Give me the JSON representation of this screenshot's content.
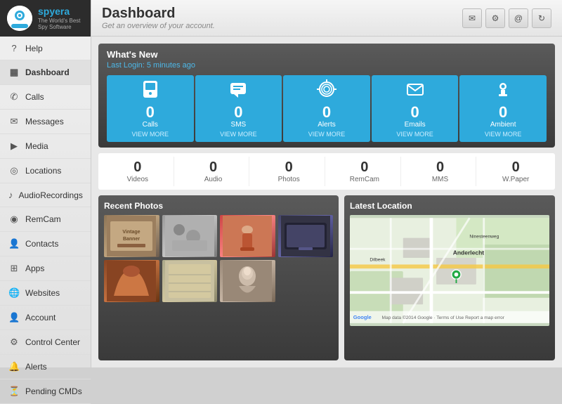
{
  "logo": {
    "text": "spyera",
    "sub": "The World's Best Spy Software"
  },
  "sidebar": {
    "items": [
      {
        "id": "help",
        "label": "Help",
        "icon": "?"
      },
      {
        "id": "dashboard",
        "label": "Dashboard",
        "icon": "▦",
        "active": true
      },
      {
        "id": "calls",
        "label": "Calls",
        "icon": "✆"
      },
      {
        "id": "messages",
        "label": "Messages",
        "icon": "✉"
      },
      {
        "id": "media",
        "label": "Media",
        "icon": "▶"
      },
      {
        "id": "locations",
        "label": "Locations",
        "icon": "◎"
      },
      {
        "id": "audiorecordings",
        "label": "AudioRecordings",
        "icon": "♪"
      },
      {
        "id": "remcam",
        "label": "RemCam",
        "icon": "◉"
      },
      {
        "id": "contacts",
        "label": "Contacts",
        "icon": "👤"
      },
      {
        "id": "apps",
        "label": "Apps",
        "icon": "⊞"
      },
      {
        "id": "websites",
        "label": "Websites",
        "icon": "🌐"
      },
      {
        "id": "account",
        "label": "Account",
        "icon": "👤"
      },
      {
        "id": "control-center",
        "label": "Control Center",
        "icon": "⚙"
      },
      {
        "id": "alerts",
        "label": "Alerts",
        "icon": "🔔"
      },
      {
        "id": "pending-cmds",
        "label": "Pending CMDs",
        "icon": "⏳"
      }
    ]
  },
  "header": {
    "title": "Dashboard",
    "subtitle": "Get an overview of your account.",
    "icons": [
      "✉",
      "⚙",
      "@",
      "↻"
    ]
  },
  "whats_new": {
    "title": "What's New",
    "last_login_label": "Last Login: 5 minutes ago"
  },
  "stats": [
    {
      "label": "Calls",
      "count": "0",
      "view_more": "VIEW MORE",
      "icon": "☎"
    },
    {
      "label": "SMS",
      "count": "0",
      "view_more": "VIEW MORE",
      "icon": "💬"
    },
    {
      "label": "Alerts",
      "count": "0",
      "view_more": "VIEW MORE",
      "icon": "📡"
    },
    {
      "label": "Emails",
      "count": "0",
      "view_more": "VIEW MORE",
      "icon": "✉"
    },
    {
      "label": "Ambient",
      "count": "0",
      "view_more": "VIEW MORE",
      "icon": "🎙"
    }
  ],
  "secondary_stats": [
    {
      "label": "Videos",
      "count": "0"
    },
    {
      "label": "Audio",
      "count": "0"
    },
    {
      "label": "Photos",
      "count": "0"
    },
    {
      "label": "RemCam",
      "count": "0"
    },
    {
      "label": "MMS",
      "count": "0"
    },
    {
      "label": "W.Paper",
      "count": "0"
    }
  ],
  "recent_photos": {
    "title": "Recent Photos",
    "photos": [
      "Vintage Banner",
      "Items",
      "Bottle",
      "Tablet",
      "Bag",
      "Documents",
      "Portrait"
    ]
  },
  "latest_location": {
    "title": "Latest Location",
    "location_name": "Anderlecht",
    "map_credit": "Map data ©2014 Google",
    "terms": "Terms of Use",
    "report": "Report a map error"
  }
}
